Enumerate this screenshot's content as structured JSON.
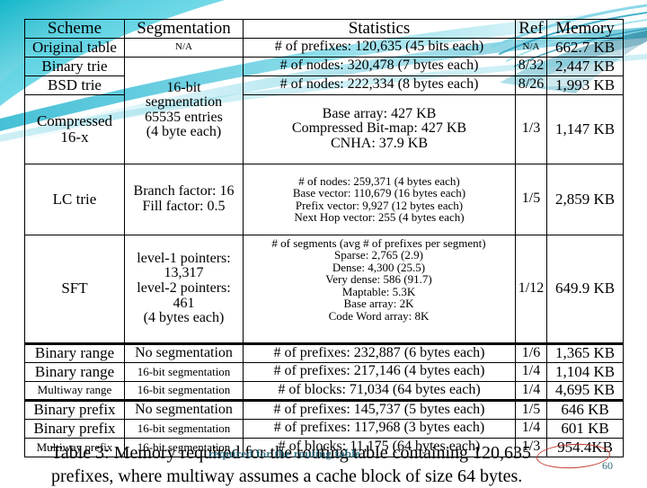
{
  "slide": {
    "page_number": "60",
    "accent_color": "#3fb6cf",
    "highlight_color": "#c0392b",
    "page_number_color": "#2e6b7a"
  },
  "table": {
    "headers": [
      "Scheme",
      "Segmentation",
      "Statistics",
      "Ref",
      "Memory"
    ],
    "rows": [
      {
        "scheme": "Original table",
        "segmentation": "N/A",
        "statistics": [
          "# of prefixes: 120,635 (45 bits each)"
        ],
        "ref": "N/A",
        "memory": "662.7 KB"
      },
      {
        "scheme": "Binary trie",
        "statistics": [
          "# of nodes: 320,478 (7 bytes each)"
        ],
        "ref": "8/32",
        "memory": "2,447 KB"
      },
      {
        "scheme": "BSD trie",
        "statistics": [
          "# of nodes: 222,334 (8 bytes each)"
        ],
        "ref": "8/26",
        "memory": "1,993 KB"
      },
      {
        "scheme": "Compressed 16-x",
        "statistics": [
          "Base array: 427 KB",
          "Compressed Bit-map: 427 KB",
          "CNHA: 37.9 KB"
        ],
        "ref": "1/3",
        "memory": "1,147 KB"
      },
      {
        "scheme": "LC trie",
        "segmentation": [
          "Branch factor: 16",
          "Fill factor: 0.5"
        ],
        "statistics": [
          "# of nodes: 259,371 (4 bytes each)",
          "Base vector: 110,679 (16 bytes each)",
          "Prefix vector: 9,927 (12 bytes each)",
          "Next Hop vector: 255 (4 bytes each)"
        ],
        "ref": "1/5",
        "memory": "2,859 KB"
      },
      {
        "scheme": "SFT",
        "segmentation": [
          "level-1 pointers:",
          "13,317",
          "level-2 pointers:",
          "461",
          "(4 bytes each)"
        ],
        "statistics": [
          "# of segments (avg # of prefixes per segment)",
          "Sparse: 2,765 (2.9)",
          "Dense: 4,300 (25.5)",
          "Very dense: 586 (91.7)",
          "Maptable: 5.3K",
          "Base array: 2K",
          "Code Word array: 8K"
        ],
        "ref": "1/12",
        "memory": "649.9 KB"
      },
      {
        "scheme": "Binary range",
        "segmentation": "No segmentation",
        "statistics": [
          "# of prefixes: 232,887 (6 bytes each)"
        ],
        "ref": "1/6",
        "memory": "1,365 KB"
      },
      {
        "scheme": "Binary range",
        "segmentation": "16-bit segmentation",
        "statistics": [
          "# of prefixes: 217,146 (4 bytes each)"
        ],
        "ref": "1/4",
        "memory": "1,104 KB"
      },
      {
        "scheme": "Multiway range",
        "segmentation": "16-bit segmentation",
        "statistics": [
          "# of blocks: 71,034 (64 bytes each)"
        ],
        "ref": "1/4",
        "memory": "4,695 KB"
      },
      {
        "scheme": "Binary prefix",
        "segmentation": "No segmentation",
        "statistics": [
          "# of prefixes: 145,737 (5 bytes each)"
        ],
        "ref": "1/5",
        "memory": "646 KB"
      },
      {
        "scheme": "Binary prefix",
        "segmentation": "16-bit segmentation",
        "statistics": [
          "# of prefixes: 117,968 (3 bytes each)"
        ],
        "ref": "1/4",
        "memory": "601 KB"
      },
      {
        "scheme": "Multiway prefix",
        "segmentation": "16-bit segmentation",
        "statistics": [
          "# of blocks: 11,175 (64 bytes each)"
        ],
        "ref": "1/3",
        "memory": "954.4KB"
      }
    ],
    "merged_segmentation_trie": [
      "16-bit",
      "segmentation",
      "65535 entries",
      "(4 byte each)"
    ]
  },
  "caption": {
    "line1": "Table 3: Memory required for the routing table containing 120,635",
    "line2": "prefixes, where multiway assumes a cache block of size 64 bytes.",
    "highlighted_number": "120,635",
    "overlay_text": "required for the routing table"
  }
}
